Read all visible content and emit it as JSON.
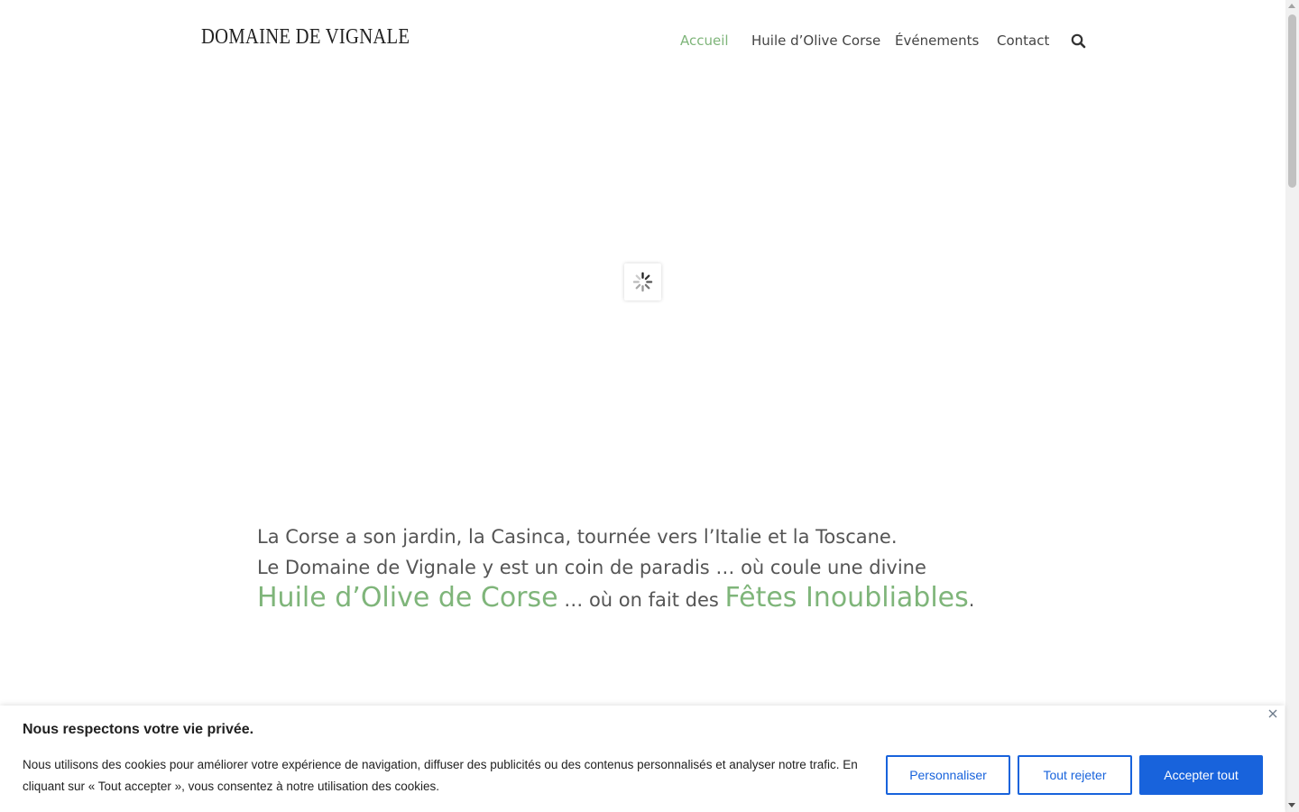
{
  "header": {
    "logo": "DOMAINE DE VIGNALE",
    "nav": [
      {
        "label": "Accueil",
        "active": true
      },
      {
        "label": "Huile d’Olive Corse",
        "active": false
      },
      {
        "label": "Événements",
        "active": false
      },
      {
        "label": "Contact",
        "active": false
      }
    ],
    "search_icon": "search-icon"
  },
  "loader": {
    "icon": "spinner-icon"
  },
  "intro": {
    "line1": "La Corse a son jardin, la Casinca, tournée vers l’Italie et la Toscane.",
    "line2_part1": "Le Domaine de Vignale y est un coin de paradis … où coule une divine ",
    "link_oil": "Huile d’Olive de Corse",
    "line2_part2": " … où on fait des ",
    "link_events": "Fêtes Inoubliables",
    "line2_end": "."
  },
  "cookie_banner": {
    "title": "Nous respectons votre vie privée.",
    "text": "Nous utilisons des cookies pour améliorer votre expérience de navigation, diffuser des publicités ou des contenus personnalisés et analyser notre trafic. En cliquant sur « Tout accepter », vous consentez à notre utilisation des cookies.",
    "customize_label": "Personnaliser",
    "reject_label": "Tout rejeter",
    "accept_label": "Accepter tout",
    "close_icon": "close-icon"
  },
  "colors": {
    "accent_green": "#7fb57a",
    "cookie_blue": "#1863dc",
    "text": "#555555"
  }
}
